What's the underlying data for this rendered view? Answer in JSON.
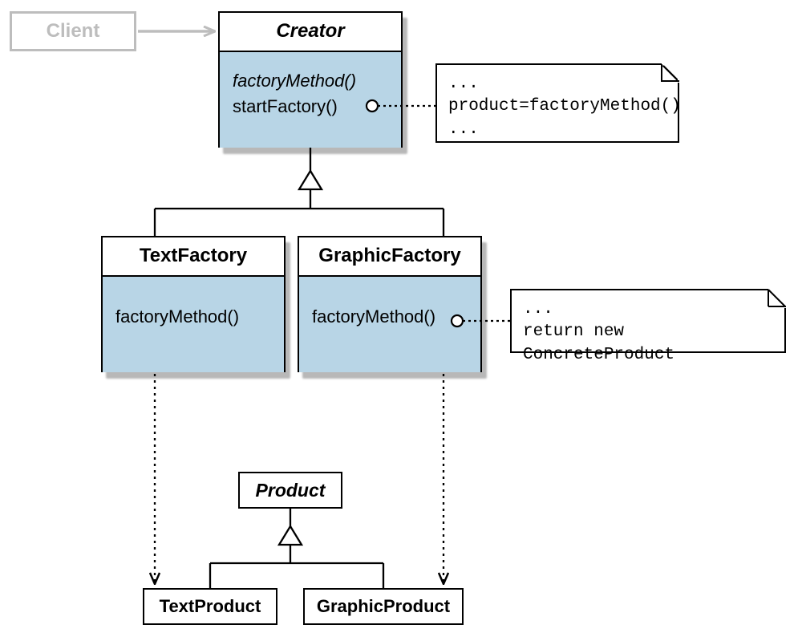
{
  "client": {
    "label": "Client"
  },
  "creator": {
    "title": "Creator",
    "method_abstract": "factoryMethod()",
    "method_concrete": "startFactory()"
  },
  "note_creator": {
    "l1": "...",
    "l2": "product=factoryMethod()",
    "l3": "..."
  },
  "text_factory": {
    "title": "TextFactory",
    "method": "factoryMethod()"
  },
  "graphic_factory": {
    "title": "GraphicFactory",
    "method": "factoryMethod()"
  },
  "note_graphic": {
    "l1": "...",
    "l2": "return new ConcreteProduct"
  },
  "product": {
    "title": "Product"
  },
  "text_product": {
    "title": "TextProduct"
  },
  "graphic_product": {
    "title": "GraphicProduct"
  }
}
